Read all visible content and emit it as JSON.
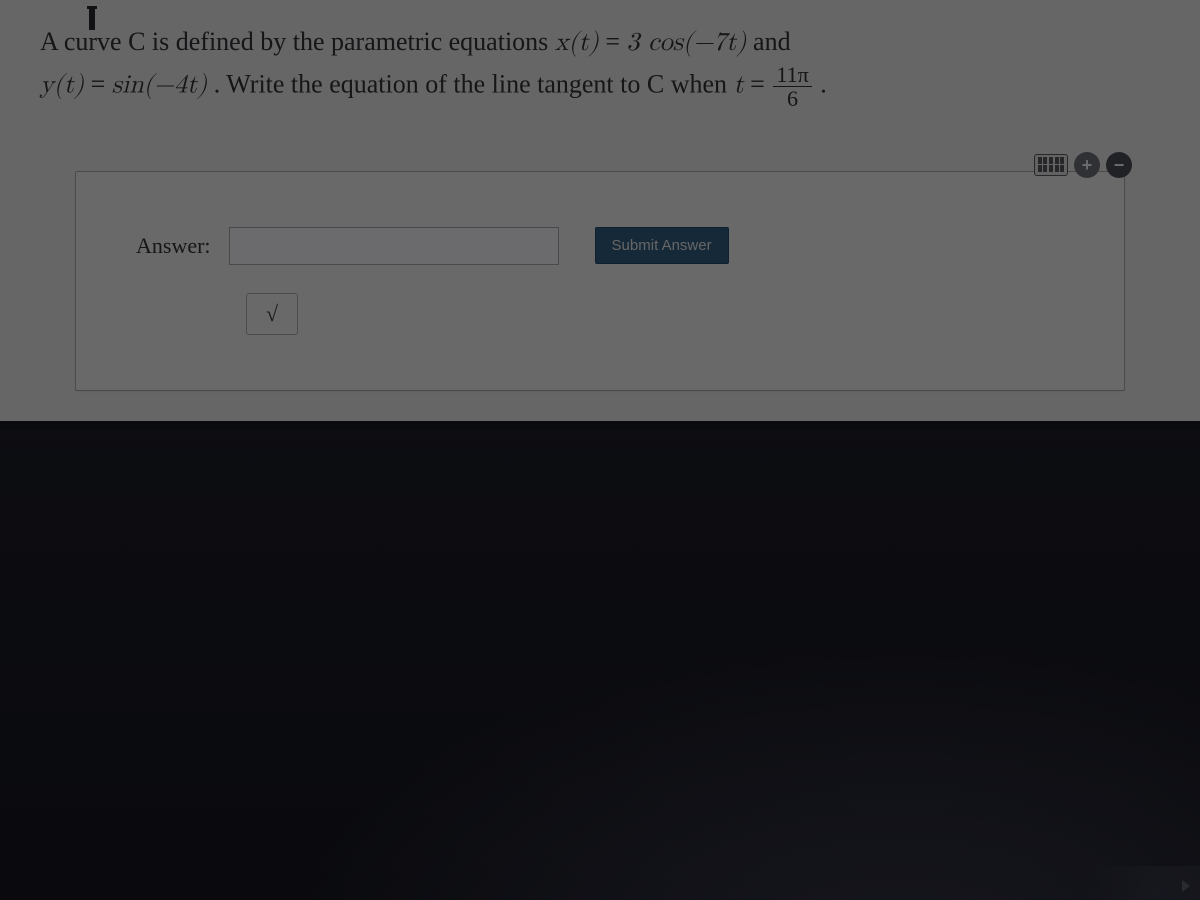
{
  "question": {
    "line1_pre": "A curve C is defined by the parametric equations ",
    "x_eq_lhs": "x(t)",
    "eq_sign": " = ",
    "x_eq_rhs": "3 cos(−7t)",
    "line1_post": " and",
    "y_eq_lhs": "y(t)",
    "y_eq_rhs": "sin(−4t)",
    "line2_mid": ". Write the equation of the line tangent to C when ",
    "t_var": "t",
    "frac_num": "11π",
    "frac_den": "6",
    "period": " ."
  },
  "answer": {
    "label": "Answer:",
    "input_value": "",
    "submit_label": "Submit Answer",
    "sqrt_symbol": "√"
  },
  "tools": {
    "plus": "+",
    "minus": "−"
  }
}
